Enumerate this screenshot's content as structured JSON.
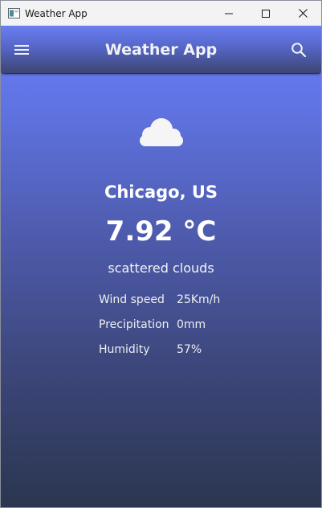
{
  "window": {
    "title": "Weather App",
    "controls": [
      "minimize",
      "maximize",
      "close"
    ]
  },
  "appbar": {
    "title": "Weather App",
    "menu_icon": "hamburger-menu-icon",
    "search_icon": "search-icon"
  },
  "weather": {
    "icon": "cloud-icon",
    "city": "Chicago, US",
    "temperature": "7.92 °C",
    "description": "scattered clouds",
    "details": [
      {
        "label": "Wind speed",
        "value": "25Km/h"
      },
      {
        "label": "Precipitation",
        "value": "0mm"
      },
      {
        "label": "Humidity",
        "value": "57%"
      }
    ]
  },
  "colors": {
    "gradient_top": "#6a7ffc",
    "gradient_bottom": "#2b3650",
    "text": "#ffffff"
  }
}
